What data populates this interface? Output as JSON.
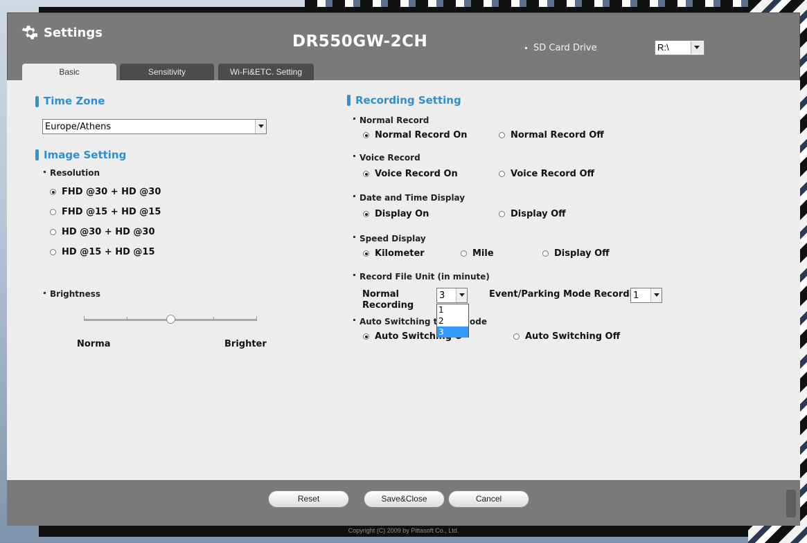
{
  "window": {
    "title": "Settings",
    "model": "DR550GW-2CH"
  },
  "sd_card": {
    "label": "SD Card Drive",
    "value": "R:\\"
  },
  "tabs": [
    {
      "label": "Basic",
      "active": true
    },
    {
      "label": "Sensitivity",
      "active": false
    },
    {
      "label": "Wi-Fi&ETC. Setting",
      "active": false
    }
  ],
  "left": {
    "time_zone": {
      "title": "Time Zone",
      "value": "Europe/Athens"
    },
    "image_setting": {
      "title": "Image Setting",
      "resolution_label": "Resolution",
      "resolution_options": [
        {
          "label": "FHD @30 + HD @30",
          "selected": true
        },
        {
          "label": "FHD @15 + HD @15",
          "selected": false
        },
        {
          "label": "HD @30 + HD @30",
          "selected": false
        },
        {
          "label": "HD @15 + HD @15",
          "selected": false
        }
      ],
      "brightness_label": "Brightness",
      "brightness_min_label": "Norma",
      "brightness_max_label": "Brighter",
      "brightness_level": 0.5
    }
  },
  "right": {
    "title": "Recording Setting",
    "normal_record": {
      "label": "Normal Record",
      "on": "Normal Record On",
      "off": "Normal Record Off",
      "value": "on"
    },
    "voice_record": {
      "label": "Voice Record",
      "on": "Voice Record On",
      "off": "Voice Record Off",
      "value": "on"
    },
    "date_time": {
      "label": "Date and Time Display",
      "on": "Display On",
      "off": "Display Off",
      "value": "on"
    },
    "speed": {
      "label": "Speed Display",
      "km": "Kilometer",
      "mile": "Mile",
      "off": "Display Off",
      "value": "km"
    },
    "file_unit": {
      "label": "Record File Unit (in minute)",
      "normal_label_1": "Normal",
      "normal_label_2": "Recording",
      "normal_value": "3",
      "normal_options": [
        "1",
        "2",
        "3"
      ],
      "event_label": "Event/Parking Mode Recording",
      "event_value": "1"
    },
    "auto_switch": {
      "label_visible": "Auto Switching to P",
      "label_tail": "ode",
      "on_visible": "Auto Switching O",
      "on_tail": "n",
      "off": "Auto Switching Off",
      "value": "on"
    }
  },
  "footer": {
    "reset": "Reset",
    "save_close": "Save&Close",
    "cancel": "Cancel"
  },
  "copyright": "Copyright (C) 2009 by Pittasoft Co., Ltd."
}
